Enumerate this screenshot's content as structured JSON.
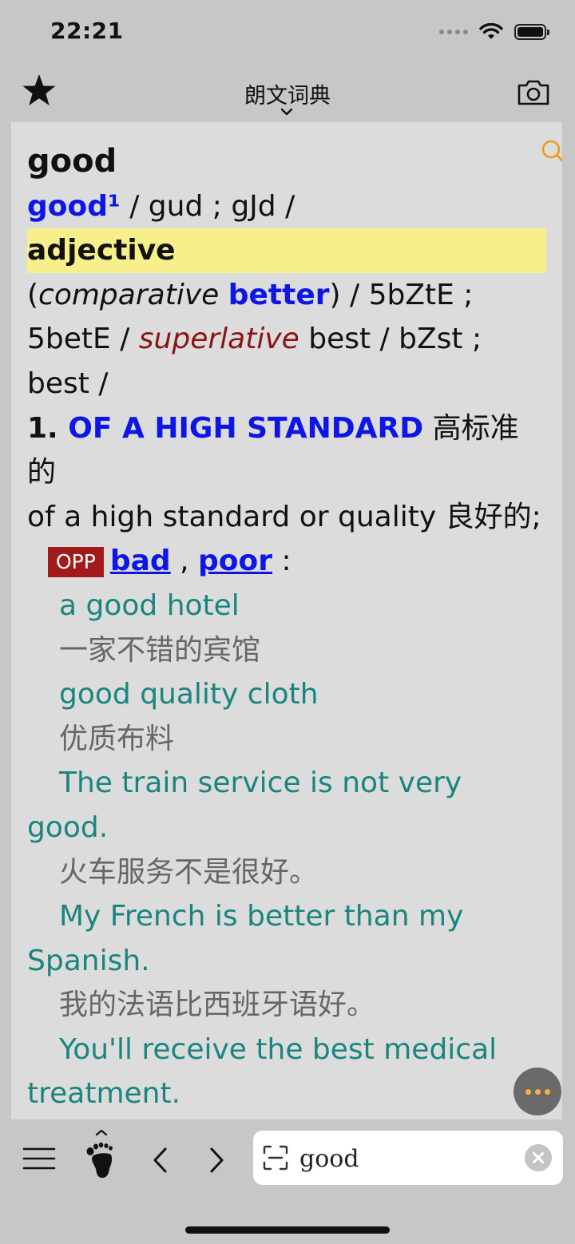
{
  "status_bar": {
    "time": "22:21"
  },
  "nav": {
    "title": "朗文词典"
  },
  "entry": {
    "headword": "good",
    "pron_word": "good¹",
    "pron": " / gud ; gJd /",
    "pos": "adjective",
    "forms": {
      "open": "(",
      "comparative_label": "comparative",
      "comparative_word": "better",
      "mid": ") / 5bZtE ; 5betE / ",
      "superlative_label": "superlative",
      "tail": " best / bZst ; best /"
    },
    "sense": {
      "number": "1. ",
      "signpost": "OF A HIGH STANDARD",
      "signpost_cn": " 高标准的",
      "definition": "of a high standard or quality 良好的;"
    },
    "opp": {
      "badge": "OPP",
      "word1": "bad",
      "sep": " , ",
      "word2": "poor",
      "end": " :"
    },
    "examples": [
      {
        "en": "a good hotel",
        "cn": "一家不错的宾馆"
      },
      {
        "en": "good quality cloth",
        "cn": "优质布料"
      },
      {
        "en": "The train service is not very good.",
        "cn": "火车服务不是很好。"
      },
      {
        "en": "My French is better than my Spanish.",
        "cn": "我的法语比西班牙语好。"
      },
      {
        "en": "You'll receive the best medical treatment.",
        "cn": ""
      }
    ]
  },
  "search": {
    "value": "good"
  },
  "colors": {
    "accent_blue": "#0d16e6",
    "example_teal": "#1a8580",
    "opp_red": "#a31a1a",
    "highlight_yellow": "#f7ef8c",
    "search_orange": "#f29a1e"
  }
}
